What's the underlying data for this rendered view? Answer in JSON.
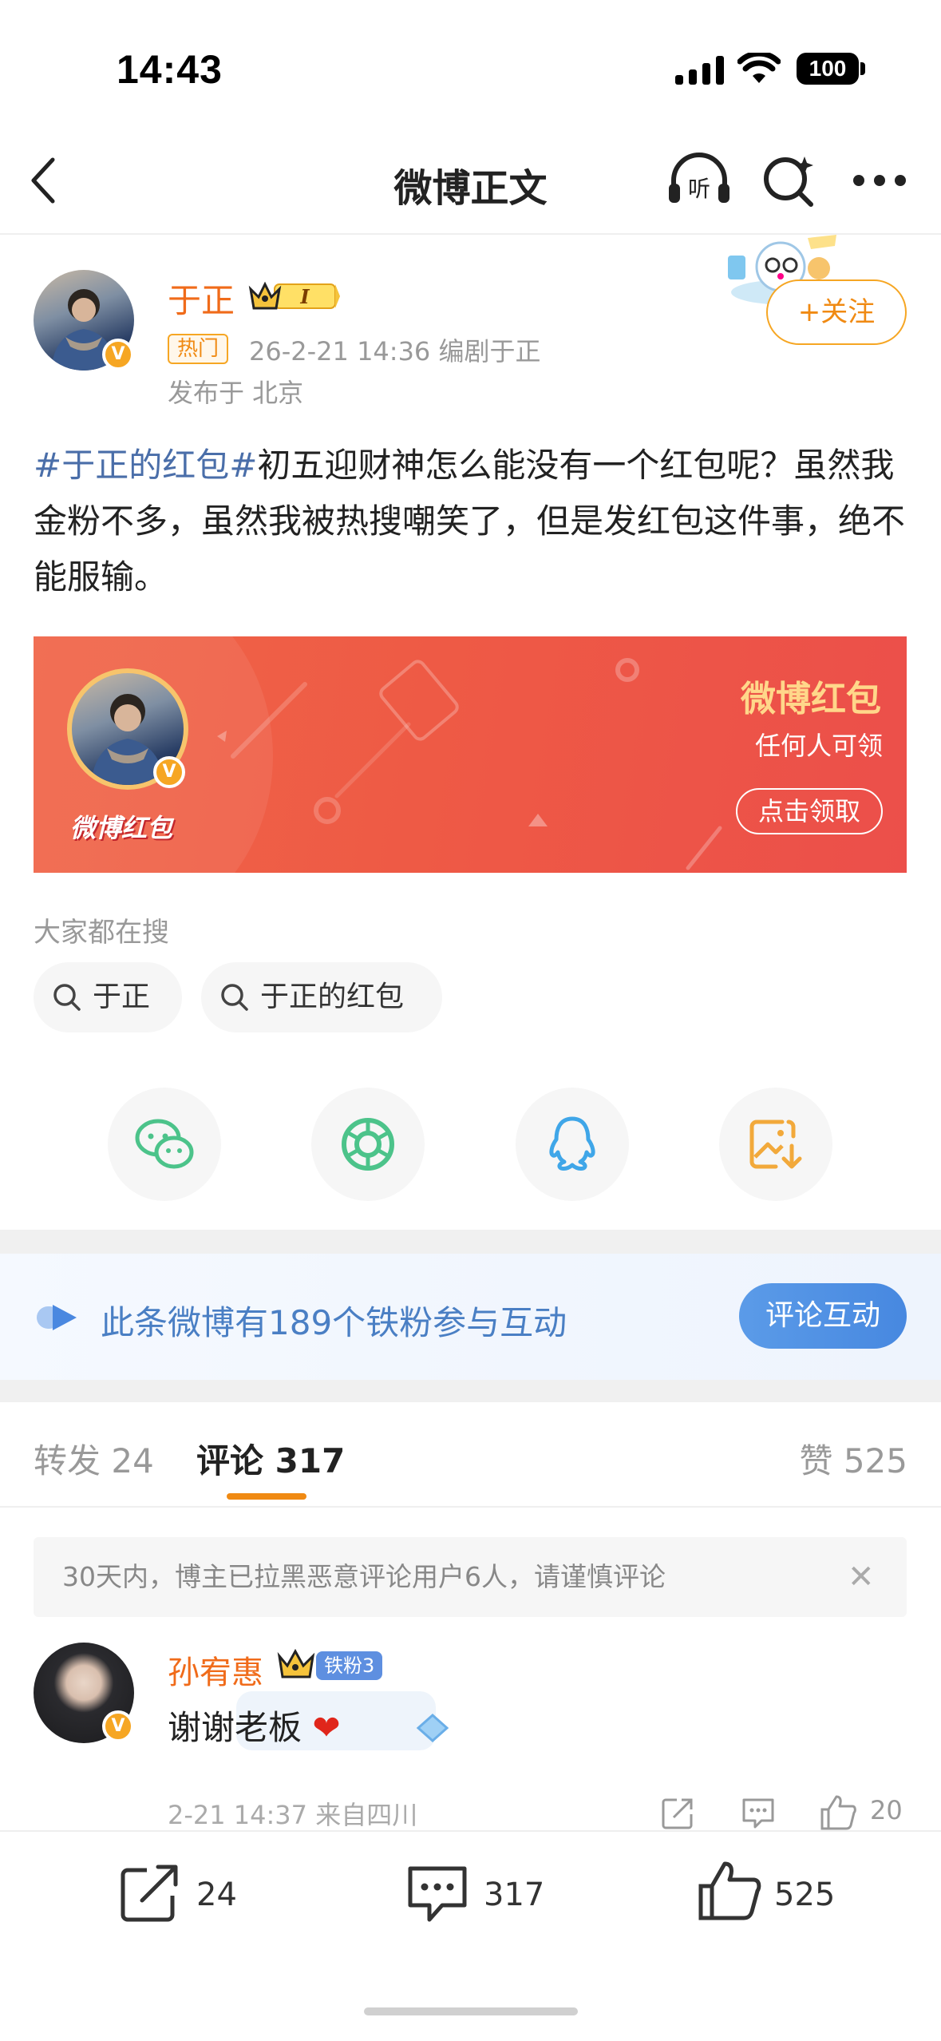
{
  "status_bar": {
    "time": "14:43",
    "battery": "100"
  },
  "nav": {
    "title": "微博正文",
    "listen_icon_label": "听"
  },
  "post": {
    "author": "于正",
    "rank_badge": "I",
    "hot_tag": "热门",
    "meta": "26-2-21 14:36  编剧于正",
    "location": "发布于 北京",
    "follow_label": "+关注",
    "topic": "#于正的红包#",
    "text": "初五迎财神怎么能没有一个红包呢？虽然我金粉不多，虽然我被热搜嘲笑了，但是发红包这件事，绝不能服输。"
  },
  "red_packet": {
    "logo": "微博红包",
    "title": "微博红包",
    "subtitle": "任何人可领",
    "button": "点击领取"
  },
  "search": {
    "label": "大家都在搜",
    "chips": [
      "于正",
      "于正的红包"
    ]
  },
  "fans_bar": {
    "text": "此条微博有189个铁粉参与互动",
    "button": "评论互动"
  },
  "tabs": {
    "repost": "转发 24",
    "comment": "评论 317",
    "like": "赞 525"
  },
  "notice": "30天内，博主已拉黑恶意评论用户6人，请谨慎评论",
  "comment": {
    "name": "孙宥惠",
    "badge": "铁粉3",
    "text": "谢谢老板",
    "meta": "2-21 14:37  来自四川",
    "likes": "20"
  },
  "bottom_bar": {
    "reposts": "24",
    "comments": "317",
    "likes": "525"
  },
  "colors": {
    "accent_orange": "#f08a13",
    "username_orange": "#f06b1a",
    "topic_blue": "#4a6ea9",
    "red_packet": "#ee5a45"
  }
}
